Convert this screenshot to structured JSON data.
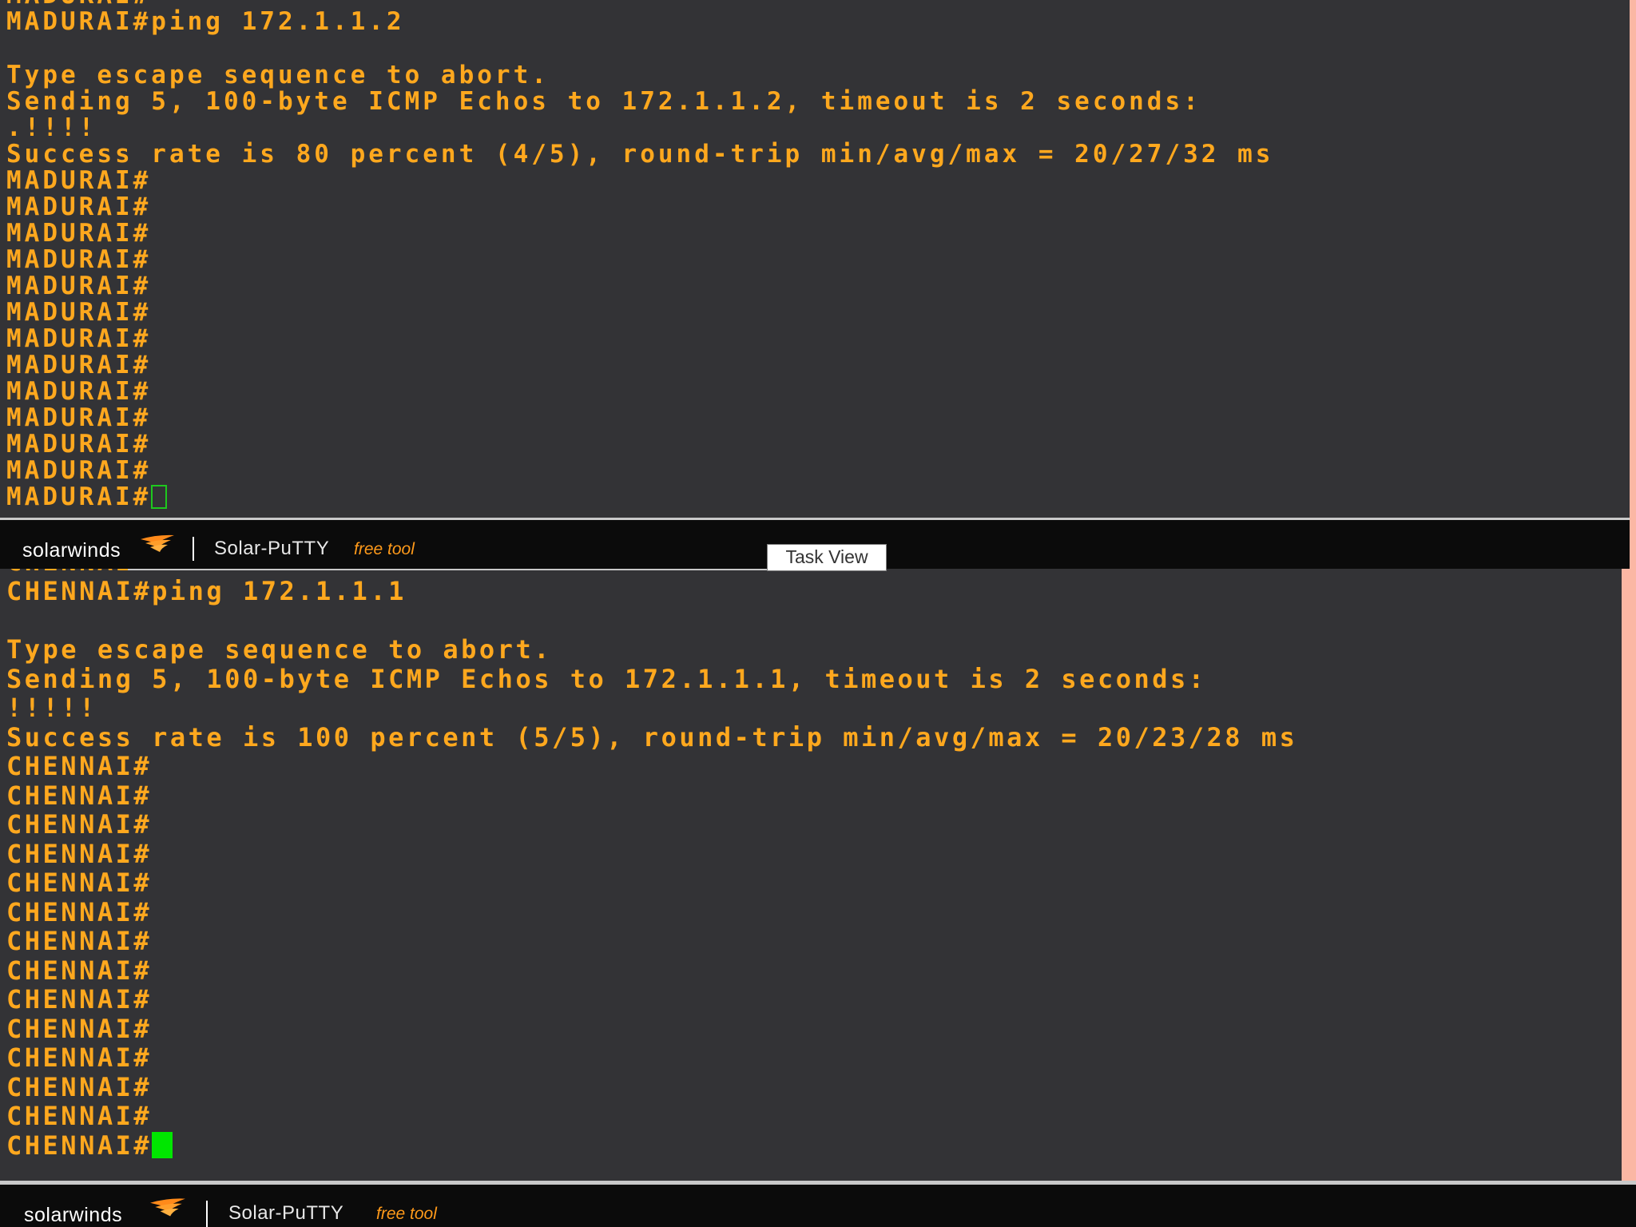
{
  "colors": {
    "terminal_bg": "#333336",
    "terminal_text": "#ffa81e",
    "cursor": "#00e600",
    "brand_bar_bg": "#0b0b0b",
    "free_tool_accent": "#ff9a1a",
    "desktop_bg": "#fbb7a4"
  },
  "top_terminal": {
    "lines": [
      "MADURAI#ping 172.1.1.2",
      "Type escape sequence to abort.",
      "Sending 5, 100-byte ICMP Echos to 172.1.1.2, timeout is 2 seconds:",
      ".!!!!",
      "Success rate is 80 percent (4/5), round-trip min/avg/max = 20/27/32 ms"
    ],
    "prompt": "MADURAI#",
    "cursor_style": "outline"
  },
  "top_brand_bar": {
    "logo_text": "solarwinds",
    "logo_icon": "solarwinds-swoosh-icon",
    "product_name": "Solar-PuTTY",
    "edition": "free tool"
  },
  "taskbar_tooltip": {
    "label": "Task View"
  },
  "bottom_terminal": {
    "lines": [
      "CHENNAI#ping 172.1.1.1",
      "Type escape sequence to abort.",
      "Sending 5, 100-byte ICMP Echos to 172.1.1.1, timeout is 2 seconds:",
      "!!!!!",
      "Success rate is 100 percent (5/5), round-trip min/avg/max = 20/23/28 ms"
    ],
    "prompt": "CHENNAI#",
    "cursor_style": "block"
  },
  "bottom_brand_bar": {
    "logo_text": "solarwinds",
    "logo_icon": "solarwinds-swoosh-icon",
    "product_name": "Solar-PuTTY",
    "edition": "free tool"
  }
}
